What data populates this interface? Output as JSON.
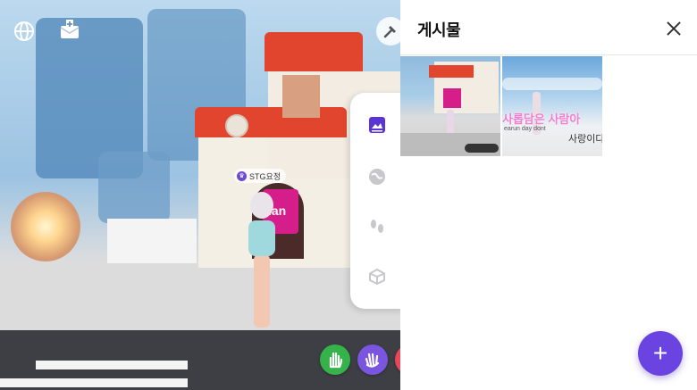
{
  "scene": {
    "player_name": "STG요정",
    "sign_text": "lan"
  },
  "hud": {
    "icons": [
      "globe-icon",
      "mail-add-icon",
      "hammer-icon"
    ]
  },
  "side_menu": {
    "items": [
      "gallery-icon",
      "world-icon",
      "footprints-icon",
      "cube-icon"
    ],
    "active": "gallery-icon",
    "accent": "#5b34d6"
  },
  "emotes": [
    {
      "name": "hand-raise-icon",
      "color": "#36b24a"
    },
    {
      "name": "wave-icon",
      "color": "#7a55e0"
    }
  ],
  "panel": {
    "title": "게시물",
    "posts": [
      {
        "id": "post-1",
        "kind": "screenshot"
      },
      {
        "id": "post-2",
        "kind": "screenshot",
        "caption": "사롭담은 사람아",
        "caption_sub": "earun day dont",
        "caption_right": "사랑이다"
      }
    ],
    "add_label": "+",
    "fab_color": "#6a43e0"
  }
}
